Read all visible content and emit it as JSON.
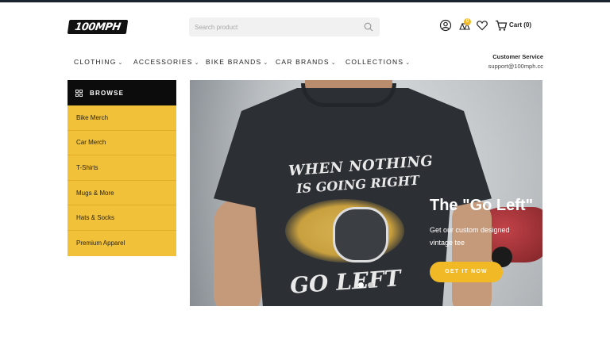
{
  "brand": {
    "logo_text": "100MPH"
  },
  "search": {
    "placeholder": "Search product"
  },
  "header": {
    "cart_label": "Cart (0)",
    "compare_count": "0"
  },
  "nav": {
    "items": [
      {
        "label": "CLOTHING"
      },
      {
        "label": "ACCESSORIES"
      },
      {
        "label": "BIKE BRANDS"
      },
      {
        "label": "CAR BRANDS"
      },
      {
        "label": "COLLECTIONS"
      }
    ]
  },
  "service": {
    "title": "Customer Service",
    "email": "support@100mph.cc"
  },
  "browse": {
    "title": "BROWSE",
    "items": [
      {
        "label": "Bike Merch"
      },
      {
        "label": "Car Merch"
      },
      {
        "label": "T-Shirts"
      },
      {
        "label": "Mugs & More"
      },
      {
        "label": "Hats & Socks"
      },
      {
        "label": "Premium Apparel"
      }
    ]
  },
  "hero": {
    "title": "The \"Go Left\"",
    "subtitle": "Get our custom designed vintage tee",
    "cta": "GET IT NOW",
    "print_line1": "WHEN NOTHING",
    "print_line2": "IS GOING RIGHT",
    "print_line3": "GO LEFT",
    "slides_total": 2,
    "active_slide": 1
  },
  "colors": {
    "accent": "#f2c13a",
    "button": "#f2b927",
    "dark": "#0c0c0c",
    "topbar": "#1a2330"
  }
}
